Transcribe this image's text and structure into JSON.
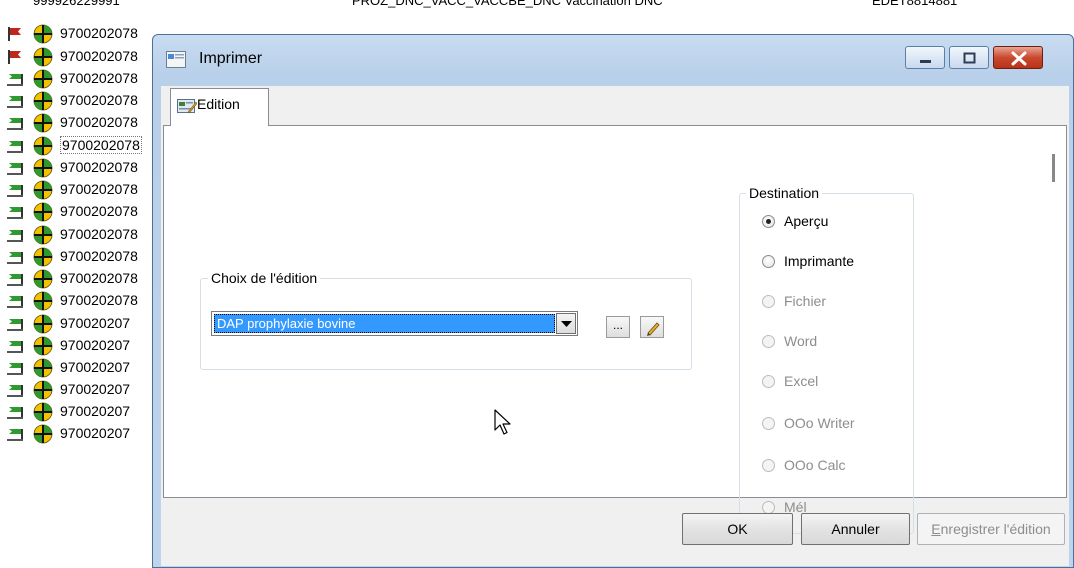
{
  "background": {
    "top_row": {
      "code": "999926229991",
      "label": "PROZ_DNC_VACC_VACCBE_DNC Vaccination DNC",
      "id": "EDET8814881"
    },
    "rows": [
      {
        "flag": "red-flag",
        "code": "9700202078"
      },
      {
        "flag": "red-flag",
        "code": "9700202078"
      },
      {
        "flag": "green-flag",
        "code": "9700202078"
      },
      {
        "flag": "green-flag",
        "code": "9700202078"
      },
      {
        "flag": "green-flag",
        "code": "9700202078"
      },
      {
        "flag": "green-flag",
        "code": "9700202078"
      },
      {
        "flag": "green-flag",
        "code": "9700202078"
      },
      {
        "flag": "green-flag",
        "code": "9700202078"
      },
      {
        "flag": "green-flag",
        "code": "9700202078"
      },
      {
        "flag": "green-flag",
        "code": "9700202078"
      },
      {
        "flag": "green-flag",
        "code": "9700202078"
      },
      {
        "flag": "green-flag",
        "code": "9700202078"
      },
      {
        "flag": "green-flag",
        "code": "9700202078"
      },
      {
        "flag": "green-flag",
        "code": "970020207"
      },
      {
        "flag": "green-flag",
        "code": "970020207"
      },
      {
        "flag": "green-flag",
        "code": "970020207"
      },
      {
        "flag": "green-flag",
        "code": "970020207"
      },
      {
        "flag": "green-flag",
        "code": "970020207"
      },
      {
        "flag": "green-flag",
        "code": "970020207"
      }
    ]
  },
  "dialog": {
    "title": "Imprimer",
    "tab_label": "Edition",
    "choix": {
      "legend": "Choix de l'édition",
      "selected": "DAP prophylaxie bovine",
      "browse_label": "..."
    },
    "destination": {
      "legend": "Destination",
      "options": [
        {
          "label": "Aperçu",
          "checked": true,
          "enabled": true
        },
        {
          "label": "Imprimante",
          "checked": false,
          "enabled": true
        },
        {
          "label": "Fichier",
          "checked": false,
          "enabled": false
        },
        {
          "label": "Word",
          "checked": false,
          "enabled": false
        },
        {
          "label": "Excel",
          "checked": false,
          "enabled": false
        },
        {
          "label": "OOo Writer",
          "checked": false,
          "enabled": false
        },
        {
          "label": "OOo Calc",
          "checked": false,
          "enabled": false
        },
        {
          "label": "Mél",
          "checked": false,
          "enabled": false
        }
      ]
    },
    "buttons": {
      "ok": "OK",
      "cancel": "Annuler",
      "save_first": "E",
      "save_rest": "nregistrer l'édition"
    }
  },
  "colors": {
    "selection": "#3399ff",
    "title_gradient": "#c8dcf1",
    "close_button": "#c9492f"
  }
}
